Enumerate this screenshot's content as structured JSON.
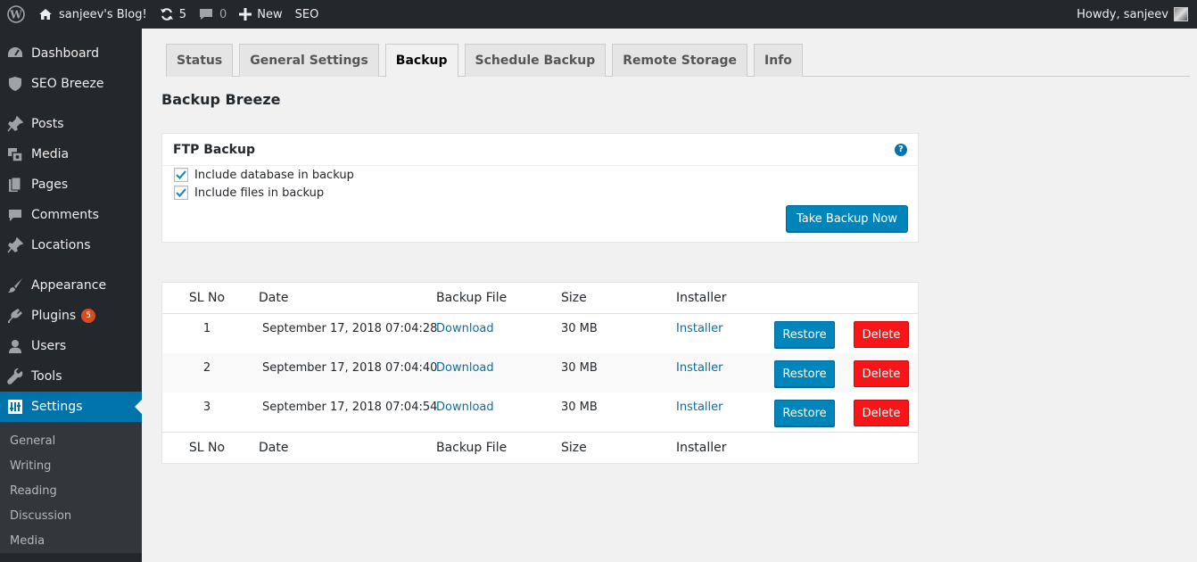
{
  "adminbar": {
    "site_name": "sanjeev's Blog!",
    "updates_count": "5",
    "comments_count": "0",
    "new_label": "New",
    "seo_label": "SEO",
    "howdy": "Howdy, sanjeev"
  },
  "sidebar": {
    "items": [
      {
        "label": "Dashboard",
        "icon": "dashboard-icon"
      },
      {
        "label": "SEO Breeze",
        "icon": "shield-icon"
      },
      {
        "label": "Posts",
        "icon": "pin-icon"
      },
      {
        "label": "Media",
        "icon": "media-icon"
      },
      {
        "label": "Pages",
        "icon": "pages-icon"
      },
      {
        "label": "Comments",
        "icon": "comment-icon"
      },
      {
        "label": "Locations",
        "icon": "pin-icon"
      },
      {
        "label": "Appearance",
        "icon": "brush-icon"
      },
      {
        "label": "Plugins",
        "icon": "plugin-icon",
        "badge": "5"
      },
      {
        "label": "Users",
        "icon": "user-icon"
      },
      {
        "label": "Tools",
        "icon": "wrench-icon"
      },
      {
        "label": "Settings",
        "icon": "settings-icon"
      }
    ],
    "submenu": [
      "General",
      "Writing",
      "Reading",
      "Discussion",
      "Media"
    ]
  },
  "tabs": [
    "Status",
    "General Settings",
    "Backup",
    "Schedule Backup",
    "Remote Storage",
    "Info"
  ],
  "active_tab": "Backup",
  "page_title": "Backup Breeze",
  "ftp": {
    "title": "FTP Backup",
    "help": "?",
    "include_db_label": "Include database in backup",
    "include_files_label": "Include files in backup",
    "include_db_checked": true,
    "include_files_checked": true,
    "take_backup_label": "Take Backup Now"
  },
  "table": {
    "headers": {
      "sl": "SL No",
      "date": "Date",
      "file": "Backup File",
      "size": "Size",
      "installer": "Installer"
    },
    "rows": [
      {
        "sl": "1",
        "date": "September 17, 2018 07:04:28",
        "file": "Download",
        "size": "30 MB",
        "installer": "Installer",
        "restore": "Restore",
        "delete": "Delete"
      },
      {
        "sl": "2",
        "date": "September 17, 2018 07:04:40",
        "file": "Download",
        "size": "30 MB",
        "installer": "Installer",
        "restore": "Restore",
        "delete": "Delete"
      },
      {
        "sl": "3",
        "date": "September 17, 2018 07:04:54",
        "file": "Download",
        "size": "30 MB",
        "installer": "Installer",
        "restore": "Restore",
        "delete": "Delete"
      }
    ]
  },
  "colors": {
    "accent": "#0073aa",
    "button": "#0085ba",
    "delete": "#f71518",
    "admin_bg": "#23282d"
  }
}
